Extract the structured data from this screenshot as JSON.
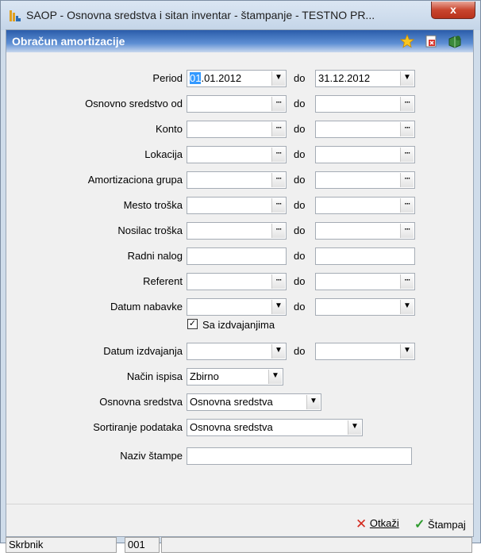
{
  "window": {
    "title": "SAOP -  Osnovna sredstva i sitan inventar - štampanje  - TESTNO PR...",
    "close": "x"
  },
  "header": {
    "title": "Obračun amortizacije"
  },
  "form": {
    "period": {
      "label": "Period",
      "from_sel": "01",
      "from_rest": ".01.2012",
      "to": "31.12.2012"
    },
    "do": "do",
    "osnovno_sredstvo_od": {
      "label": "Osnovno sredstvo od"
    },
    "konto": {
      "label": "Konto"
    },
    "lokacija": {
      "label": "Lokacija"
    },
    "amort_grupa": {
      "label": "Amortizaciona grupa"
    },
    "mesto_troska": {
      "label": "Mesto troška"
    },
    "nosilac_troska": {
      "label": "Nosilac troška"
    },
    "radni_nalog": {
      "label": "Radni nalog"
    },
    "referent": {
      "label": "Referent"
    },
    "datum_nabavke": {
      "label": "Datum nabavke"
    },
    "sa_izdvajanjima": {
      "label": "Sa izdvajanjima",
      "checked": true
    },
    "datum_izdvajanja": {
      "label": "Datum izdvajanja"
    },
    "nacin_ispisa": {
      "label": "Način ispisa",
      "value": "Zbirno"
    },
    "osnovna_sredstva": {
      "label": "Osnovna sredstva",
      "value": "Osnovna sredstva"
    },
    "sortiranje": {
      "label": "Sortiranje podataka",
      "value": "Osnovna sredstva"
    },
    "naziv_stampe": {
      "label": "Naziv štampe",
      "value": ""
    }
  },
  "actions": {
    "cancel": "Otkaži",
    "print": "Štampaj"
  },
  "status": {
    "user": "Skrbnik",
    "code": "001"
  }
}
